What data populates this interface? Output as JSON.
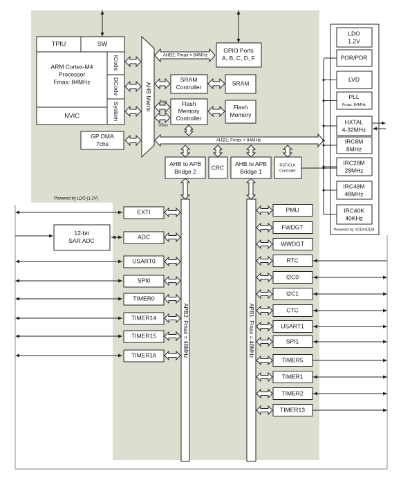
{
  "colors": {
    "region": "#dcdfcf",
    "frame": "#a0a0a0",
    "box_stroke": "#222222"
  },
  "core": {
    "tpiu": "TPIU",
    "sw": "SW",
    "processor": [
      "ARM Cortex-M4",
      "Processor",
      "Fmax: 84MHz"
    ],
    "icode": "ICode",
    "dcode": "DCode",
    "system": "System",
    "nvic": "NVIC",
    "gp_dma": [
      "GP DMA",
      "7chs"
    ],
    "ahb_matrix": "AHB Matrix",
    "powered_ldo": "Powered by LDO (1.2V)"
  },
  "ahb": {
    "ahb2_label": "AHB2: Fmax = 84MHz",
    "ahb1_label": "AHB1: Fmax = 84MHz",
    "gpio": [
      "GPIO Ports",
      "A, B, C, D, F"
    ],
    "sram_ctrl": [
      "SRAM",
      "Controller"
    ],
    "sram": "SRAM",
    "flash_ctrl": [
      "Flash",
      "Memory",
      "Controller"
    ],
    "flash": [
      "Flash",
      "Memory"
    ],
    "ibus": "IBus",
    "dbus": "DBus",
    "bridge2": [
      "AHB to APB",
      "Bridge 2"
    ],
    "crc": "CRC",
    "bridge1": [
      "AHB to APB",
      "Bridge 1"
    ],
    "rstclk": [
      "RST/CLK",
      "Controller"
    ]
  },
  "apb2": {
    "label": "APB2: Fmax = 48MHz",
    "adc12": [
      "12-bit",
      "SAR ADC"
    ],
    "peripherals": [
      "EXTI",
      "ADC",
      "USART0",
      "SPI0",
      "TIMER0",
      "TIMER14",
      "TIMER15",
      "TIMER16"
    ]
  },
  "apb1": {
    "label": "APB1: Fmax = 48MHz",
    "peripherals": [
      "PMU",
      "FWDGT",
      "WWDGT",
      "RTC",
      "I2C0",
      "I2C1",
      "CTC",
      "USART1",
      "SPI1",
      "TIMER5",
      "TIMER1",
      "TIMER2",
      "TIMER13"
    ]
  },
  "power_clock": {
    "blocks": [
      [
        "LDO",
        "1.2V"
      ],
      [
        "POR/PDR"
      ],
      [
        "LVD"
      ],
      [
        "PLL",
        "Fmax: 84MHz"
      ],
      [
        "HXTAL",
        "4-32MHz"
      ],
      [
        "IRC8M",
        "8MHz"
      ],
      [
        "IRC28M",
        "28MHz"
      ],
      [
        "IRC48M",
        "48MHz"
      ],
      [
        "IRC40K",
        "40KHz"
      ]
    ],
    "powered": "Powered by VDD/VDDA"
  }
}
